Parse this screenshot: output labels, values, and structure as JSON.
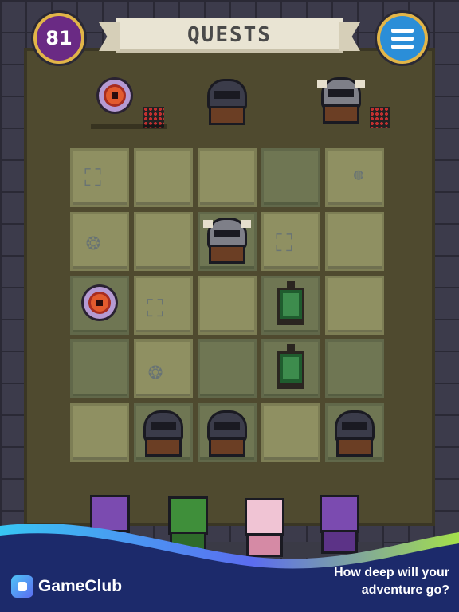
{
  "header": {
    "title": "QUESTS",
    "level": "81",
    "menu_icon": "hamburger-menu-icon"
  },
  "colors": {
    "floor": "#4f4a2f",
    "tile": "#8f9062",
    "banner": "#e9e4d3",
    "level_badge": "#6a2a84",
    "menu_button": "#2b8ed8",
    "badge_ring": "#e2b548",
    "promo_blue": "#1c2a6b"
  },
  "board": {
    "rows": 5,
    "cols": 5,
    "tiles": [
      [
        "rubble-icon",
        "empty",
        "empty",
        "empty",
        "pebble-icon"
      ],
      [
        "rock-icon",
        "empty",
        "horned-knight-icon",
        "rubble-icon",
        "empty"
      ],
      [
        "eye-monster-icon",
        "rubble-icon",
        "empty",
        "lantern-icon",
        "empty"
      ],
      [
        "empty",
        "rock-icon",
        "empty",
        "lantern-icon",
        "empty"
      ],
      [
        "empty",
        "dark-knight-icon",
        "dark-knight-icon",
        "empty",
        "dark-knight-icon"
      ]
    ]
  },
  "preview_enemies": [
    "eye-monster-icon",
    "dark-knight-icon",
    "horned-knight-icon"
  ],
  "heroes": [
    "purple-knight-icon",
    "green-ranger-icon",
    "pink-cleric-icon",
    "purple-knight-icon"
  ],
  "promo": {
    "brand": "GameClub",
    "tagline": "How deep will your adventure go?"
  }
}
